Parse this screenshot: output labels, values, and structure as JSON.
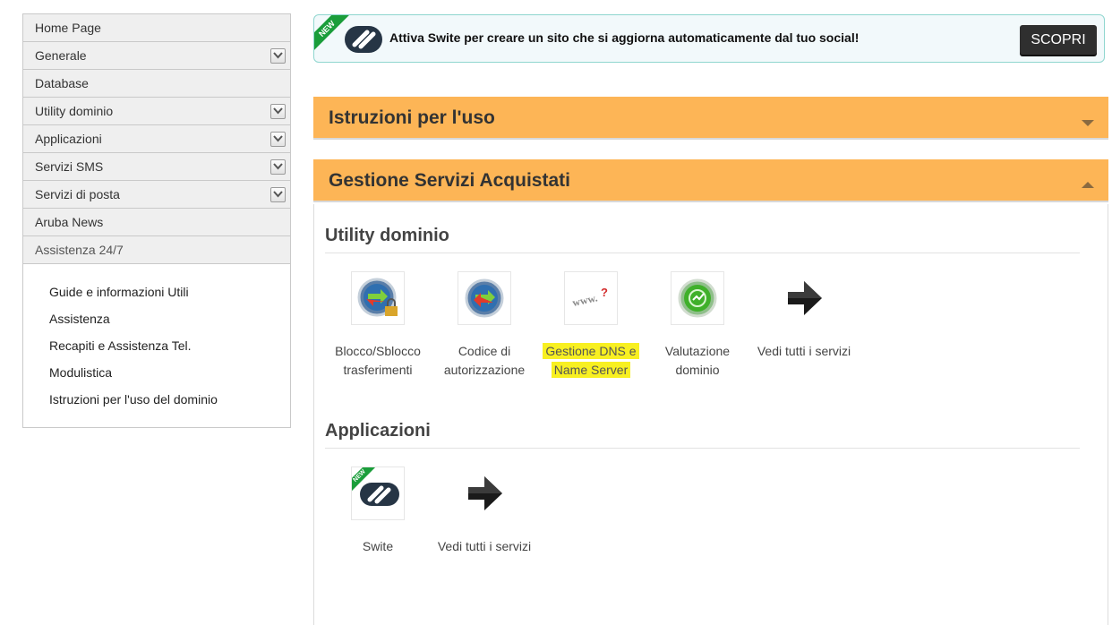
{
  "sidebar": {
    "items": [
      {
        "label": "Home Page",
        "expandable": false
      },
      {
        "label": "Generale",
        "expandable": true
      },
      {
        "label": "Database",
        "expandable": false
      },
      {
        "label": "Utility dominio",
        "expandable": true
      },
      {
        "label": "Applicazioni",
        "expandable": true
      },
      {
        "label": "Servizi SMS",
        "expandable": true
      },
      {
        "label": "Servizi di posta",
        "expandable": true
      },
      {
        "label": "Aruba News",
        "expandable": false
      },
      {
        "label": "Assistenza 24/7",
        "expandable": false
      }
    ],
    "submenu": [
      "Guide e informazioni Utili",
      "Assistenza",
      "Recapiti e Assistenza Tel.",
      "Modulistica",
      "Istruzioni per l'uso del dominio"
    ]
  },
  "banner": {
    "badge": "NEW",
    "text": "Attiva Swite per creare un sito che si aggiorna automaticamente dal tuo social!",
    "button": "SCOPRI"
  },
  "panels": {
    "instructions": {
      "title": "Istruzioni per l'uso",
      "state": "collapsed"
    },
    "services": {
      "title": "Gestione Servizi Acquistati",
      "state": "expanded"
    }
  },
  "utility_dominio": {
    "title": "Utility dominio",
    "tiles": [
      {
        "line1": "Blocco/Sblocco",
        "line2": "trasferimenti",
        "icon": "lock-transfer-icon"
      },
      {
        "line1": "Codice di",
        "line2": "autorizzazione",
        "icon": "auth-code-icon"
      },
      {
        "line1": "Gestione DNS e",
        "line2": "Name Server",
        "icon": "dns-www-icon",
        "highlighted": true
      },
      {
        "line1": "Valutazione",
        "line2": "dominio",
        "icon": "domain-valuation-icon"
      },
      {
        "line1": "Vedi tutti i servizi",
        "line2": "",
        "icon": "arrow-right-icon"
      }
    ]
  },
  "applicazioni": {
    "title": "Applicazioni",
    "tiles": [
      {
        "line1": "Swite",
        "icon": "swite-icon",
        "badge": "NEW"
      },
      {
        "line1": "Vedi tutti i servizi",
        "icon": "arrow-right-icon"
      }
    ]
  },
  "colors": {
    "panel_header": "#fdb556",
    "highlight": "#f8f021",
    "sidebar_bg": "#efefef",
    "banner_bg": "#f2f9fb",
    "new_badge": "#1a9d3a"
  }
}
